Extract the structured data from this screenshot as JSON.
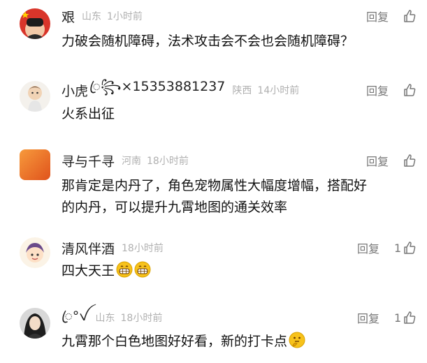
{
  "comments": [
    {
      "username": "艰",
      "location": "山东",
      "time": "1小时前",
      "reply_label": "回复",
      "text": "力破会随机障碍，法术攻击会不会也会随机障碍？"
    },
    {
      "username": "小虎",
      "username_suffix": "ꦿ꧂×15353881237",
      "location": "陕西",
      "time": "14小时前",
      "reply_label": "回复",
      "text": "火系出征"
    },
    {
      "username": "寻与千寻",
      "location": "河南",
      "time": "18小时前",
      "reply_label": "回复",
      "text_line1": "那肯定是内丹了，角色宠物属性大幅度增幅，搭配好",
      "text_line2": "的内丹，可以提升九霄地图的通关效率"
    },
    {
      "username": "清风伴酒",
      "time": "18小时前",
      "reply_label": "回复",
      "like_count": "1",
      "text": "四大天王"
    },
    {
      "username": "ꦿ°ꪜ",
      "location": "山东",
      "time": "18小时前",
      "reply_label": "回复",
      "like_count": "1",
      "text": "九霄那个白色地图好好看，新的打卡点"
    }
  ],
  "colors": {
    "text": "#111111",
    "meta": "#b0b0b0",
    "action": "#777777"
  }
}
